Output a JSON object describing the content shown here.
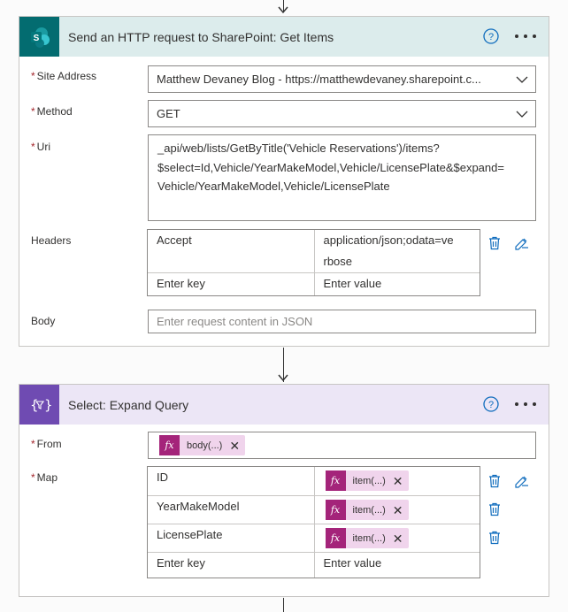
{
  "http_action": {
    "title": "Send an HTTP request to SharePoint: Get Items",
    "brand_color": "#036c70",
    "header_bg": "#dcecec",
    "fields": {
      "site_address": {
        "label": "Site Address",
        "value": "Matthew Devaney Blog - https://matthewdevaney.sharepoint.c..."
      },
      "method": {
        "label": "Method",
        "value": "GET"
      },
      "uri": {
        "label": "Uri",
        "lines": [
          "_api/web/lists/GetByTitle('Vehicle Reservations')/items?",
          "$select=Id,Vehicle/YearMakeModel,Vehicle/LicensePlate&$expand=",
          "Vehicle/YearMakeModel,Vehicle/LicensePlate"
        ]
      },
      "headers": {
        "label": "Headers",
        "rows": [
          {
            "key": "Accept",
            "value_lines": [
              "application/json;odata=ve",
              "rbose"
            ]
          }
        ],
        "key_placeholder": "Enter key",
        "value_placeholder": "Enter value"
      },
      "body": {
        "label": "Body",
        "placeholder": "Enter request content in JSON"
      }
    }
  },
  "select_action": {
    "title": "Select: Expand Query",
    "brand_color": "#6f4bb2",
    "header_bg": "#ece6f6",
    "fields": {
      "from": {
        "label": "From",
        "token": "body(...)"
      },
      "map": {
        "label": "Map",
        "rows": [
          {
            "key": "ID",
            "token": "item(...)"
          },
          {
            "key": "YearMakeModel",
            "token": "item(...)"
          },
          {
            "key": "LicensePlate",
            "token": "item(...)"
          }
        ],
        "key_placeholder": "Enter key",
        "value_placeholder": "Enter value"
      }
    }
  },
  "icons": {
    "help": "help-circle-icon",
    "more": "ellipsis-icon",
    "delete": "trash-icon",
    "switch_text_mode": "switch-mode-icon",
    "dropdown": "chevron-down-icon",
    "expression": "fx-icon",
    "remove": "close-icon"
  },
  "accent_color": "#0f6cbd",
  "token_color": "#a4247a"
}
